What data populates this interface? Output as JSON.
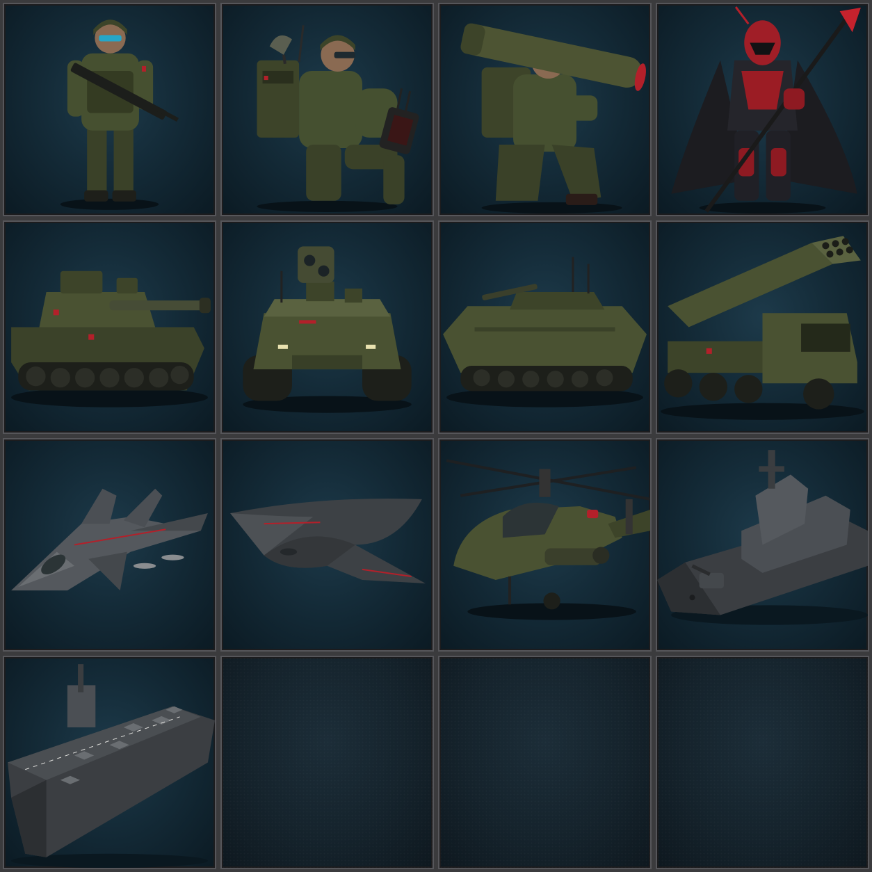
{
  "colors": {
    "frame": "#3b3b3d",
    "tile_border": "#56565a",
    "background_teal": "#142b38",
    "camo_olive": "#4a5232",
    "camo_dark": "#2c3220",
    "steel_gray": "#4b4f54",
    "accent_red": "#b3202a"
  },
  "tiles": [
    {
      "icon": "rifleman-soldier-icon"
    },
    {
      "icon": "radio-operator-soldier-icon"
    },
    {
      "icon": "rocket-launcher-soldier-icon"
    },
    {
      "icon": "red-armored-spear-warrior-icon"
    },
    {
      "icon": "main-battle-tank-icon"
    },
    {
      "icon": "tracked-robot-drone-icon"
    },
    {
      "icon": "infantry-fighting-vehicle-icon"
    },
    {
      "icon": "rocket-artillery-truck-icon"
    },
    {
      "icon": "stealth-fighter-jet-icon"
    },
    {
      "icon": "stealth-bomber-icon"
    },
    {
      "icon": "attack-helicopter-icon"
    },
    {
      "icon": "destroyer-warship-icon"
    },
    {
      "icon": "aircraft-carrier-icon"
    },
    {
      "icon": "empty-slot"
    },
    {
      "icon": "empty-slot"
    },
    {
      "icon": "empty-slot"
    }
  ]
}
